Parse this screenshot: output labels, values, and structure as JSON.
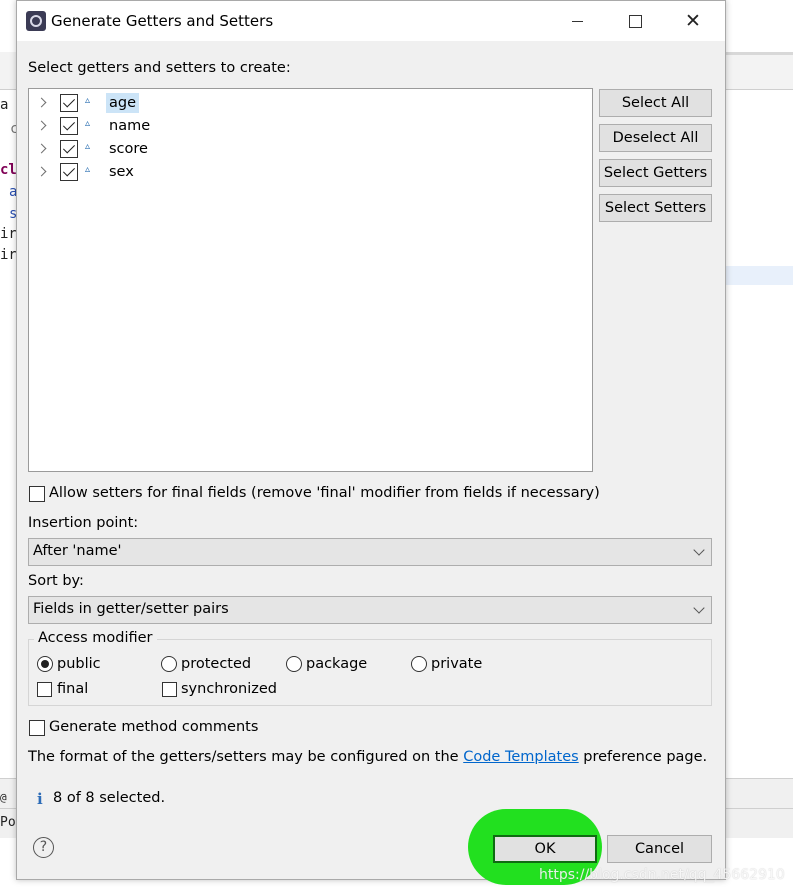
{
  "background_editor": {
    "code_fragments": [
      "a",
      "c",
      "cl",
      "a",
      "s",
      "ir",
      "ir"
    ],
    "bottom_fragments": [
      "@",
      "Po"
    ]
  },
  "dialog": {
    "title": "Generate Getters and Setters",
    "window_controls": {
      "minimize": "minimize-icon",
      "maximize": "maximize-icon",
      "close": "✕"
    },
    "prompt": "Select getters and setters to create:",
    "fields": [
      {
        "name": "age",
        "checked": true,
        "selected": true
      },
      {
        "name": "name",
        "checked": true,
        "selected": false
      },
      {
        "name": "score",
        "checked": true,
        "selected": false
      },
      {
        "name": "sex",
        "checked": true,
        "selected": false
      }
    ],
    "side_buttons": {
      "select_all": "Select All",
      "deselect_all": "Deselect All",
      "select_getters": "Select Getters",
      "select_setters": "Select Setters"
    },
    "allow_final_label": "Allow setters for final fields (remove 'final' modifier from fields if necessary)",
    "allow_final_checked": false,
    "insertion_point": {
      "label": "Insertion point:",
      "value": "After 'name'"
    },
    "sort_by": {
      "label": "Sort by:",
      "value": "Fields in getter/setter pairs"
    },
    "access_modifier": {
      "title": "Access modifier",
      "options": [
        "public",
        "protected",
        "package",
        "private"
      ],
      "selected": "public",
      "final_label": "final",
      "synchronized_label": "synchronized"
    },
    "generate_comments_label": "Generate method comments",
    "format_note": {
      "before": "The format of the getters/setters may be configured on the",
      "link": "Code Templates",
      "after": "preference page."
    },
    "status": "8 of 8 selected.",
    "ok_label": "OK",
    "cancel_label": "Cancel",
    "highlight_color": "#22e01f"
  },
  "watermark": "https://blog.csdn.net/qq_45662910"
}
